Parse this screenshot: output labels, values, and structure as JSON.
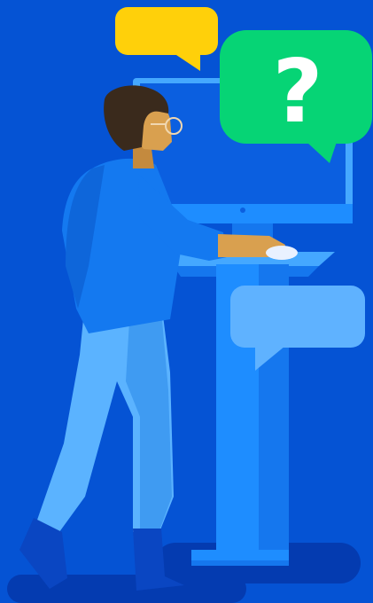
{
  "illustration": {
    "help_bubble_text": "?"
  },
  "colors": {
    "background": "#0553D4",
    "bubble_yellow": "#FFD00A",
    "bubble_green": "#06D475",
    "bubble_light_blue": "#5FB2FF",
    "kiosk_blue": "#1E8DFF",
    "shirt_blue": "#1479F0",
    "pants_light_blue": "#5BB3FF",
    "skin": "#D9A04F",
    "hair": "#3A2A1C"
  }
}
